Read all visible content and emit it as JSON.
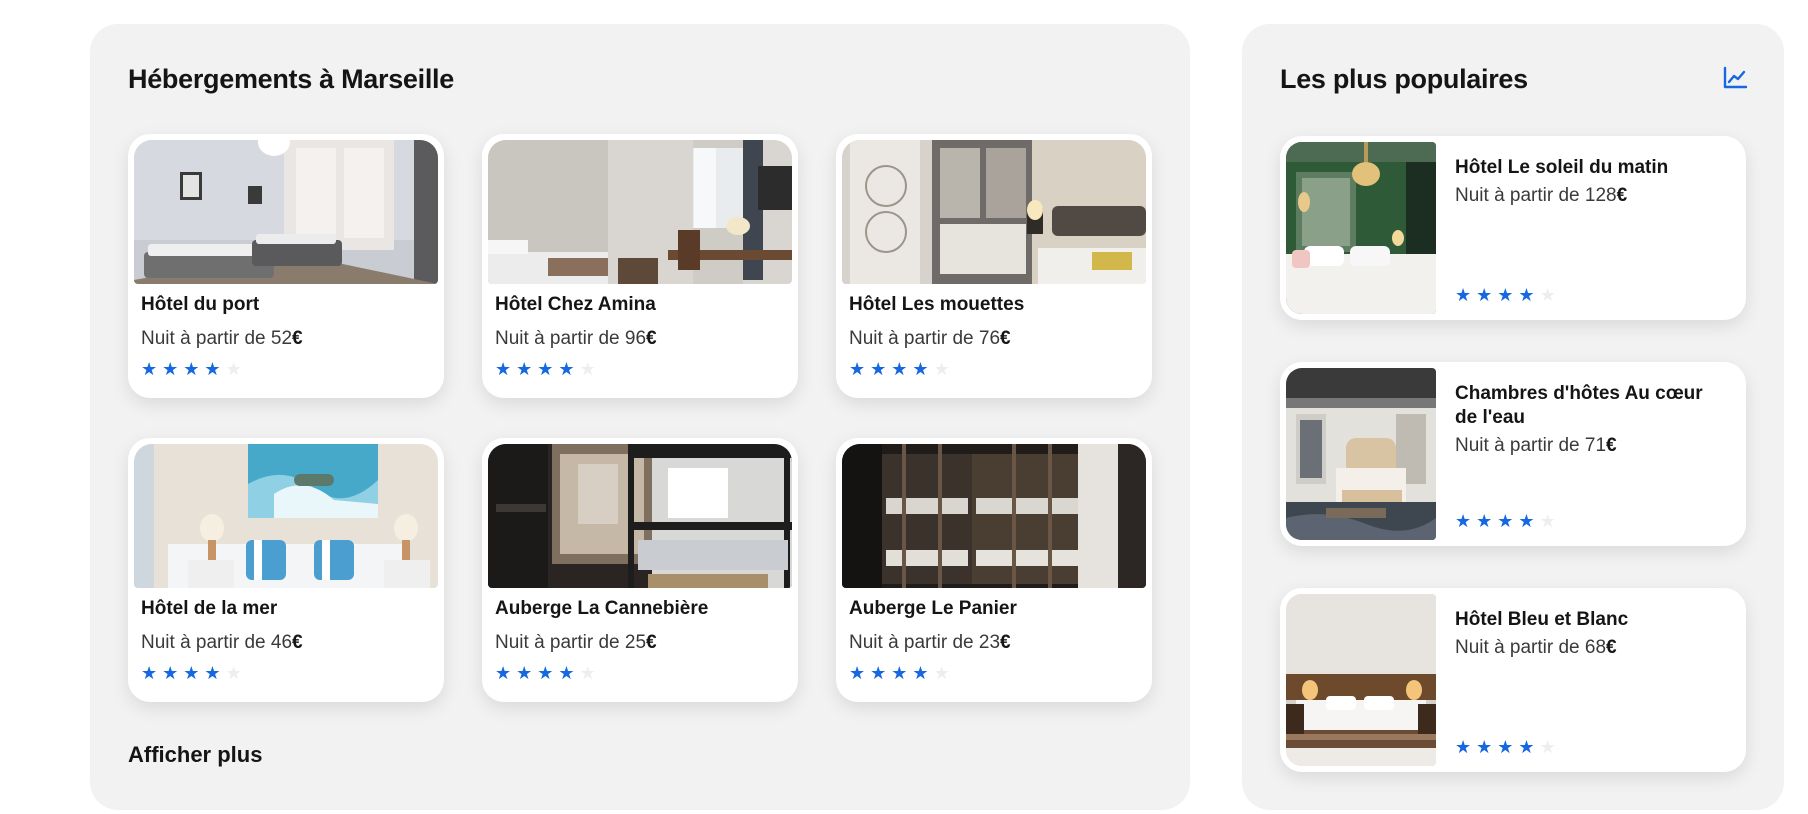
{
  "main": {
    "title": "Hébergements à Marseille",
    "price_prefix": "Nuit à partir de ",
    "currency": "€",
    "more_label": "Afficher plus",
    "hotels": [
      {
        "name": "Hôtel du port",
        "price": "52",
        "rating": 4,
        "image": "room-grey-twin-beds"
      },
      {
        "name": "Hôtel Chez Amina",
        "price": "96",
        "rating": 4,
        "image": "room-window-desk"
      },
      {
        "name": "Hôtel Les mouettes",
        "price": "76",
        "rating": 4,
        "image": "room-mirror-wardrobe"
      },
      {
        "name": "Hôtel de la mer",
        "price": "46",
        "rating": 4,
        "image": "room-sea-painting"
      },
      {
        "name": "Auberge La Cannebière",
        "price": "25",
        "rating": 4,
        "image": "dorm-bunk-beds-window"
      },
      {
        "name": "Auberge Le Panier",
        "price": "23",
        "rating": 4,
        "image": "dorm-wooden-bunks"
      }
    ]
  },
  "popular": {
    "title": "Les plus populaires",
    "icon": "trend-chart-icon",
    "price_prefix": "Nuit à partir de ",
    "currency": "€",
    "hotels": [
      {
        "name": "Hôtel Le soleil du matin",
        "price": "128",
        "rating": 4,
        "image": "room-green-chandelier"
      },
      {
        "name": "Chambres d'hôtes Au cœur de l'eau",
        "price": "71",
        "rating": 4,
        "image": "room-loft-bed"
      },
      {
        "name": "Hôtel Bleu et Blanc",
        "price": "68",
        "rating": 4,
        "image": "room-warm-lamps"
      }
    ]
  },
  "colors": {
    "accent": "#1668e0",
    "panel": "#f2f2f2",
    "star_off": "#eeeeee"
  },
  "max_rating": 5
}
